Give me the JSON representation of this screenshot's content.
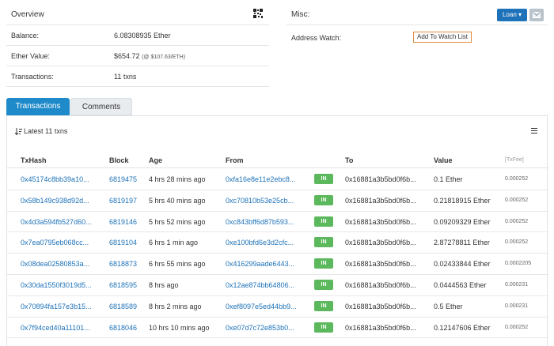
{
  "overview": {
    "title": "Overview",
    "rows": [
      {
        "label": "Balance:",
        "value": "6.08308935 Ether",
        "sub": ""
      },
      {
        "label": "Ether Value:",
        "value": "$654.72",
        "sub": "(@ $107.63/ETH)"
      },
      {
        "label": "Transactions:",
        "value": "11 txns",
        "sub": ""
      }
    ]
  },
  "misc": {
    "title": "Misc:",
    "loan_label": "Loan ▾",
    "address_watch_label": "Address Watch:",
    "add_watch_label": "Add To Watch List"
  },
  "tabs": [
    {
      "label": "Transactions"
    },
    {
      "label": "Comments"
    }
  ],
  "list": {
    "latest_label": "Latest 11 txns"
  },
  "table": {
    "headers": {
      "hash": "TxHash",
      "block": "Block",
      "age": "Age",
      "from": "From",
      "to": "To",
      "value": "Value",
      "fee": "[TxFee]"
    },
    "rows": [
      {
        "hash": "0x45174c8bb39a10...",
        "block": "6819475",
        "age": "4 hrs 28 mins ago",
        "from": "0xfa16e8e11e2ebc8...",
        "dir": "IN",
        "to": "0x16881a3b5bd0f6b...",
        "value": "0.1 Ether",
        "fee": "0.000252"
      },
      {
        "hash": "0x58b149c938d92d...",
        "block": "6819197",
        "age": "5 hrs 40 mins ago",
        "from": "0xc70810b53e25cb...",
        "dir": "IN",
        "to": "0x16881a3b5bd0f6b...",
        "value": "0.21818915 Ether",
        "fee": "0.000252"
      },
      {
        "hash": "0x4d3a594fb527d60...",
        "block": "6819146",
        "age": "5 hrs 52 mins ago",
        "from": "0xc843bff6d87b593...",
        "dir": "IN",
        "to": "0x16881a3b5bd0f6b...",
        "value": "0.09209329 Ether",
        "fee": "0.000252"
      },
      {
        "hash": "0x7ea0795eb068cc...",
        "block": "6819104",
        "age": "6 hrs 1 min ago",
        "from": "0xe100bfd6e3d2cfc...",
        "dir": "IN",
        "to": "0x16881a3b5bd0f6b...",
        "value": "2.87278811 Ether",
        "fee": "0.000252"
      },
      {
        "hash": "0x08dea02580853a...",
        "block": "6818873",
        "age": "6 hrs 55 mins ago",
        "from": "0x416299aade6443...",
        "dir": "IN",
        "to": "0x16881a3b5bd0f6b...",
        "value": "0.02433844 Ether",
        "fee": "0.0002205"
      },
      {
        "hash": "0x30da1550f3019d5...",
        "block": "6818595",
        "age": "8 hrs ago",
        "from": "0x12ae874bb64806...",
        "dir": "IN",
        "to": "0x16881a3b5bd0f6b...",
        "value": "0.0444563 Ether",
        "fee": "0.000231"
      },
      {
        "hash": "0x70894fa157e3b15...",
        "block": "6818589",
        "age": "8 hrs 2 mins ago",
        "from": "0xef8097e5ed44bb9...",
        "dir": "IN",
        "to": "0x16881a3b5bd0f6b...",
        "value": "0.5 Ether",
        "fee": "0.000231"
      },
      {
        "hash": "0x7f94ced40a11101...",
        "block": "6818046",
        "age": "10 hrs 10 mins ago",
        "from": "0xe07d7c72e853b0...",
        "dir": "IN",
        "to": "0x16881a3b5bd0f6b...",
        "value": "0.12147606 Ether",
        "fee": "0.000252"
      }
    ]
  },
  "colors": {
    "accent": "#1f8ac9",
    "link": "#1e72b9",
    "in_badge": "#5cb85c",
    "watch_border": "#e08a3c"
  },
  "icons": {
    "qr": "qr-code-icon",
    "mail": "mail-icon",
    "sort": "sort-icon",
    "menu": "menu-icon"
  }
}
